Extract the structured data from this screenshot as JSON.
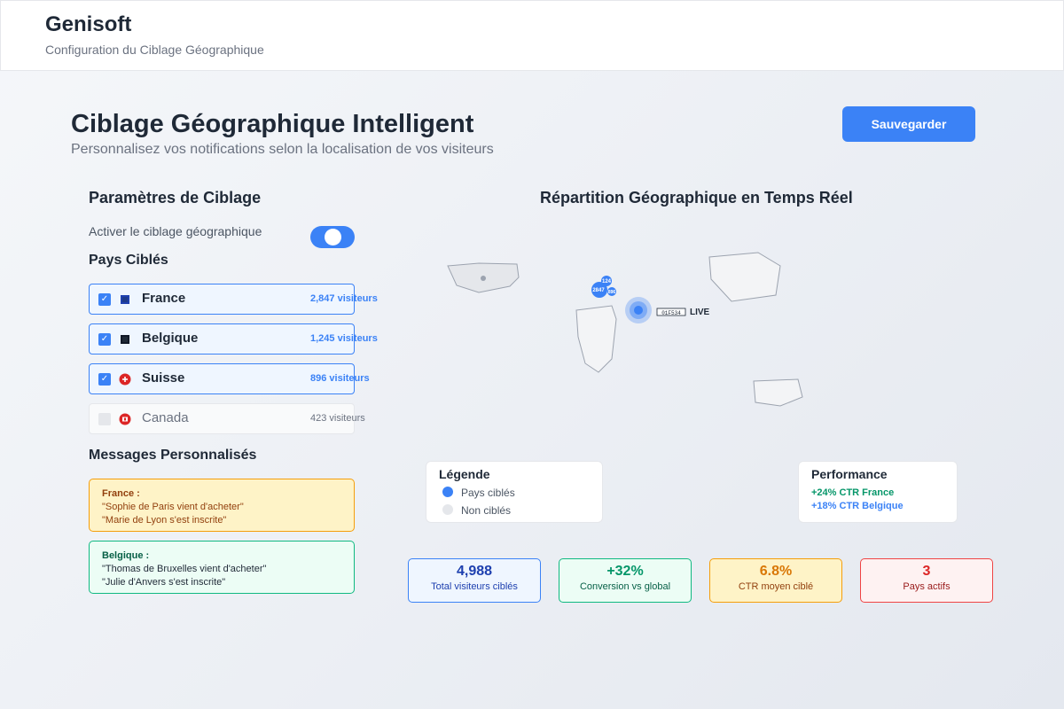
{
  "header": {
    "app_name": "Genisoft",
    "subtitle": "Configuration du Ciblage Géographique"
  },
  "page": {
    "title": "Ciblage Géographique Intelligent",
    "subtitle": "Personnalisez vos notifications selon la localisation de vos visiteurs",
    "save_label": "Sauvegarder"
  },
  "settings": {
    "title": "Paramètres de Ciblage",
    "toggle_label": "Activer le ciblage géographique",
    "toggle_on": true,
    "countries_title": "Pays Ciblés",
    "countries": [
      {
        "name": "France",
        "visitors": "2,847 visiteurs",
        "checked": true,
        "check_mark": "✓",
        "flag_color": "#1e40af"
      },
      {
        "name": "Belgique",
        "visitors": "1,245 visiteurs",
        "checked": true,
        "check_mark": "✓",
        "flag_color": "#111827"
      },
      {
        "name": "Suisse",
        "visitors": "896 visiteurs",
        "checked": true,
        "check_mark": "✓",
        "flag_color": "#dc2626"
      },
      {
        "name": "Canada",
        "visitors": "423 visiteurs",
        "checked": false,
        "check_mark": "",
        "flag_color": "#dc2626"
      }
    ]
  },
  "messages": {
    "title": "Messages Personnalisés",
    "items": [
      {
        "country": "France :",
        "lines": [
          "\"Sophie de Paris vient d'acheter\"",
          "\"Marie de Lyon s'est inscrite\""
        ]
      },
      {
        "country": "Belgique :",
        "lines": [
          "\"Thomas de Bruxelles vient d'acheter\"",
          "\"Julie d'Anvers s'est inscrite\""
        ]
      }
    ]
  },
  "map": {
    "title": "Répartition Géographique en Temps Réel",
    "bubbles": [
      "124",
      "2847",
      "896"
    ],
    "live_code": "01F534",
    "live_label": "LIVE"
  },
  "legend": {
    "title": "Légende",
    "targeted": "Pays ciblés",
    "not_targeted": "Non ciblés",
    "targeted_color": "#3b82f6",
    "not_targeted_color": "#e5e7eb"
  },
  "performance": {
    "title": "Performance",
    "lines": [
      {
        "text": "+24% CTR France",
        "color": "#059669"
      },
      {
        "text": "+18% CTR Belgique",
        "color": "#3b82f6"
      }
    ]
  },
  "stats": [
    {
      "value": "4,988",
      "label": "Total visiteurs ciblés",
      "color": "#1e40af",
      "bg": "#eff6ff",
      "border": "#3b82f6"
    },
    {
      "value": "+32%",
      "label": "Conversion vs global",
      "color": "#059669",
      "bg": "#ecfdf5",
      "border": "#10b981"
    },
    {
      "value": "6.8%",
      "label": "CTR moyen ciblé",
      "color": "#d97706",
      "bg": "#fef3c7",
      "border": "#f59e0b"
    },
    {
      "value": "3",
      "label": "Pays actifs",
      "color": "#dc2626",
      "bg": "#fef2f2",
      "border": "#ef4444"
    }
  ]
}
